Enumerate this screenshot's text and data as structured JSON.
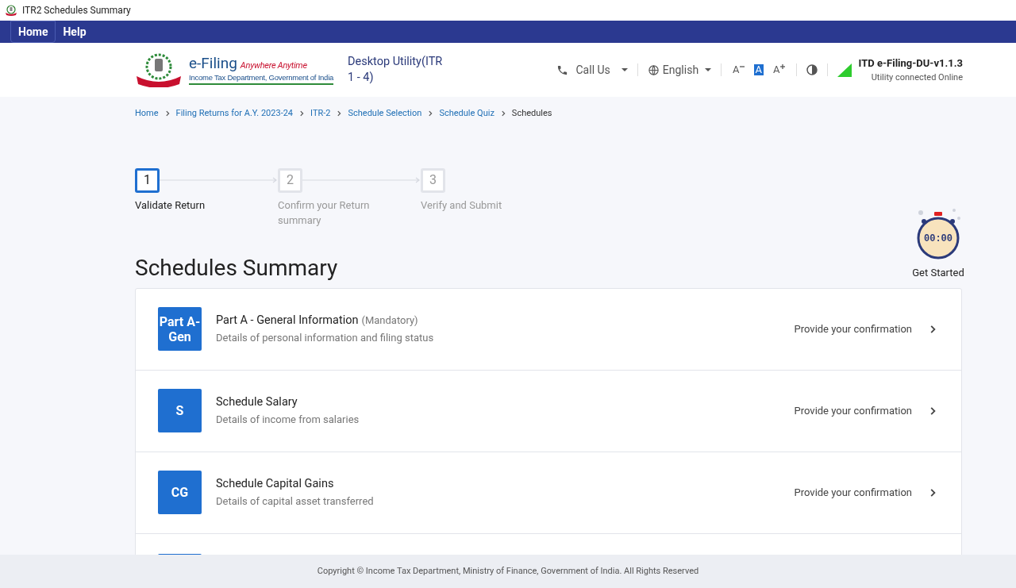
{
  "window": {
    "title": "ITR2 Schedules Summary"
  },
  "menu": [
    {
      "label": "Home",
      "selected": true
    },
    {
      "label": "Help",
      "selected": false
    }
  ],
  "header": {
    "logo_title": "e-Filing",
    "logo_tagline": "Anywhere Anytime",
    "logo_subtitle": "Income Tax Department, Government of India",
    "app_name": "Desktop Utility(ITR 1 - 4)",
    "call_us": "Call Us",
    "language": "English",
    "font_sizes": [
      {
        "label": "A",
        "kind": "decrease",
        "selected": false
      },
      {
        "label": "A",
        "kind": "normal",
        "selected": true
      },
      {
        "label": "A",
        "kind": "increase",
        "selected": false
      }
    ],
    "version": "ITD e-Filing-DU-v1.1.3",
    "connection": "Utility connected Online"
  },
  "breadcrumb": [
    "Home",
    "Filing Returns for A.Y. 2023-24",
    "ITR-2",
    "Schedule Selection",
    "Schedule Quiz",
    "Schedules"
  ],
  "steps": [
    {
      "number": "1",
      "label": "Validate Return",
      "selected": true
    },
    {
      "number": "2",
      "label": "Confirm your Return summary",
      "selected": false
    },
    {
      "number": "3",
      "label": "Verify and Submit",
      "selected": false
    }
  ],
  "title": "Schedules Summary",
  "timer": {
    "display": "00:00",
    "label": "Get Started"
  },
  "schedules": [
    {
      "badge": "Part A-Gen",
      "name": "Part A - General Information",
      "note": "(Mandatory)",
      "description": "Details of personal information and filing status",
      "action": "Provide your confirmation"
    },
    {
      "badge": "S",
      "name": "Schedule Salary",
      "description": "Details of income from salaries",
      "action": "Provide your confirmation"
    },
    {
      "badge": "CG",
      "name": "Schedule Capital Gains",
      "description": "Details of capital asset transferred",
      "action": "Provide your confirmation"
    }
  ],
  "footer": "Copyright © Income Tax Department, Ministry of Finance, Government of India. All Rights Reserved"
}
